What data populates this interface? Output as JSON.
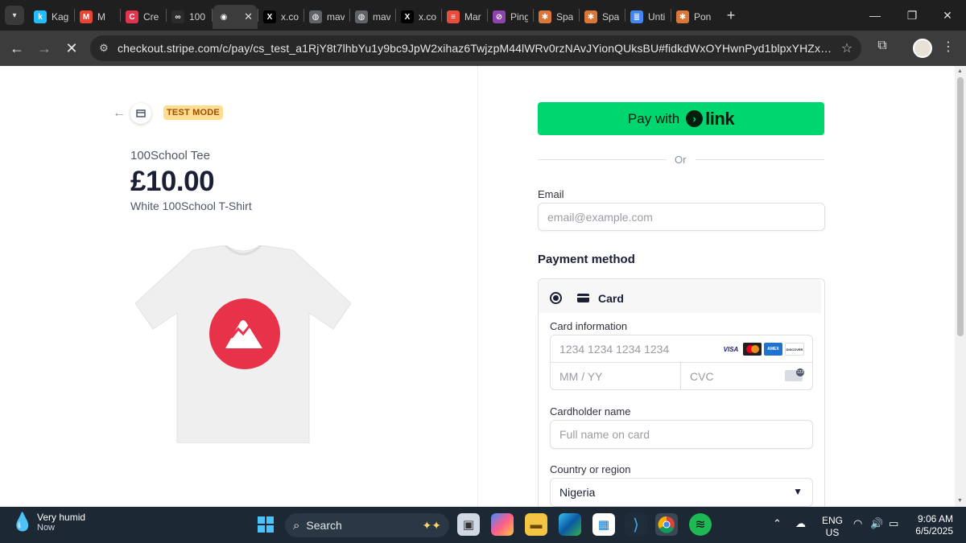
{
  "browser": {
    "tabs": [
      {
        "title": "Kag",
        "fav": "#20beff",
        "glyph": "k",
        "active": false
      },
      {
        "title": "M",
        "fav": "#ea4335",
        "glyph": "M",
        "active": false
      },
      {
        "title": "Cre",
        "fav": "#e2344f",
        "glyph": "C",
        "active": false
      },
      {
        "title": "100",
        "fav": "#2b2b2b",
        "glyph": "∞",
        "active": false
      },
      {
        "title": "",
        "fav": "#3c3c3c",
        "glyph": "◉",
        "active": true
      },
      {
        "title": "x.co",
        "fav": "#000000",
        "glyph": "X",
        "active": false
      },
      {
        "title": "mav",
        "fav": "#5f6368",
        "glyph": "◍",
        "active": false
      },
      {
        "title": "mav",
        "fav": "#5f6368",
        "glyph": "◍",
        "active": false
      },
      {
        "title": "x.co",
        "fav": "#000000",
        "glyph": "X",
        "active": false
      },
      {
        "title": "Mar",
        "fav": "#e74c3c",
        "glyph": "≡",
        "active": false
      },
      {
        "title": "Ping",
        "fav": "#8e44ad",
        "glyph": "⊘",
        "active": false
      },
      {
        "title": "Spa",
        "fav": "#d9773b",
        "glyph": "✱",
        "active": false
      },
      {
        "title": "Spa",
        "fav": "#d9773b",
        "glyph": "✱",
        "active": false
      },
      {
        "title": "Unti",
        "fav": "#4285f4",
        "glyph": "≣",
        "active": false
      },
      {
        "title": "Pon",
        "fav": "#d9773b",
        "glyph": "✱",
        "active": false
      }
    ],
    "url": "checkout.stripe.com/c/pay/cs_test_a1RjY8t7lhbYu1y9bc9JpW2xihaz6TwjzpM44lWRv0rzNAvJYionQUksBU#fidkdWxOYHwnPyd1blpxYHZxWjA0V0FVSktX..."
  },
  "product": {
    "badge": "TEST MODE",
    "name": "100School Tee",
    "price": "£10.00",
    "description": "White 100School T-Shirt"
  },
  "checkout": {
    "pay_with": "Pay with",
    "link_word": "link",
    "or": "Or",
    "email_label": "Email",
    "email_placeholder": "email@example.com",
    "payment_method_title": "Payment method",
    "card_option": "Card",
    "card_info_label": "Card information",
    "card_number_placeholder": "1234 1234 1234 1234",
    "expiry_placeholder": "MM / YY",
    "cvc_placeholder": "CVC",
    "card_brands": [
      "VISA",
      "mastercard",
      "AMEX",
      "DISCOVER"
    ],
    "cardholder_label": "Cardholder name",
    "cardholder_placeholder": "Full name on card",
    "country_label": "Country or region",
    "country_value": "Nigeria"
  },
  "taskbar": {
    "weather_title": "Very humid",
    "weather_sub": "Now",
    "search_label": "Search",
    "lang": "ENG",
    "region": "US",
    "time": "9:06 AM",
    "date": "6/5/2025"
  },
  "colors": {
    "link_green": "#00d66f",
    "test_badge_bg": "#ffde92",
    "logo_red": "#e8324a"
  }
}
